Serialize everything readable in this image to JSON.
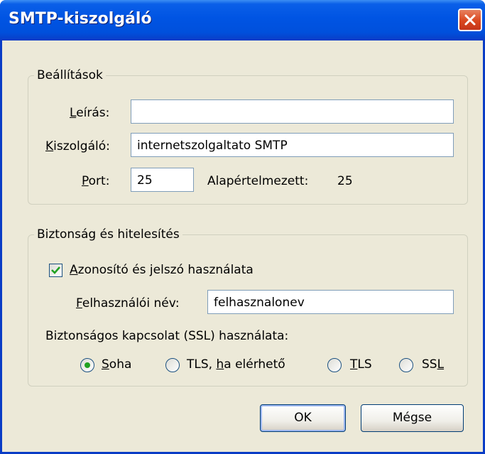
{
  "window": {
    "title": "SMTP-kiszolgáló"
  },
  "settings": {
    "legend": "Beállítások",
    "description": {
      "label_u": "L",
      "label_rest": "eírás:",
      "value": ""
    },
    "server": {
      "label_u": "K",
      "label_rest": "iszolgáló:",
      "value": "internetszolgaltato SMTP"
    },
    "port": {
      "label_u": "P",
      "label_rest": "ort:",
      "value": "25",
      "default_label": "Alapértelmezett:",
      "default_value": "25"
    }
  },
  "security": {
    "legend": "Biztonság és hitelesítés",
    "use_auth": {
      "label_u": "A",
      "label_rest": "zonosító és jelszó használata",
      "checked": true
    },
    "username": {
      "label_u": "F",
      "label_rest": "elhasználói név:",
      "value": "felhasznalonev"
    },
    "ssl_label": "Biztonságos kapcsolat (SSL) használata:",
    "options": [
      {
        "pre": "",
        "u": "S",
        "post": "oha",
        "selected": true
      },
      {
        "pre": "TLS, ",
        "u": "h",
        "post": "a elérhető",
        "selected": false
      },
      {
        "pre": "",
        "u": "T",
        "post": "LS",
        "selected": false
      },
      {
        "pre": "SS",
        "u": "L",
        "post": "",
        "selected": false
      }
    ]
  },
  "buttons": {
    "ok": "OK",
    "cancel": "Mégse"
  },
  "colors": {
    "title_bar": "#0054e3",
    "dialog_bg": "#ece9d8",
    "close_button": "#d9471f",
    "check_accent": "#21a121"
  },
  "icons": {
    "close": "close-icon",
    "check": "check-icon",
    "radio_dot": "radio-dot-icon"
  }
}
